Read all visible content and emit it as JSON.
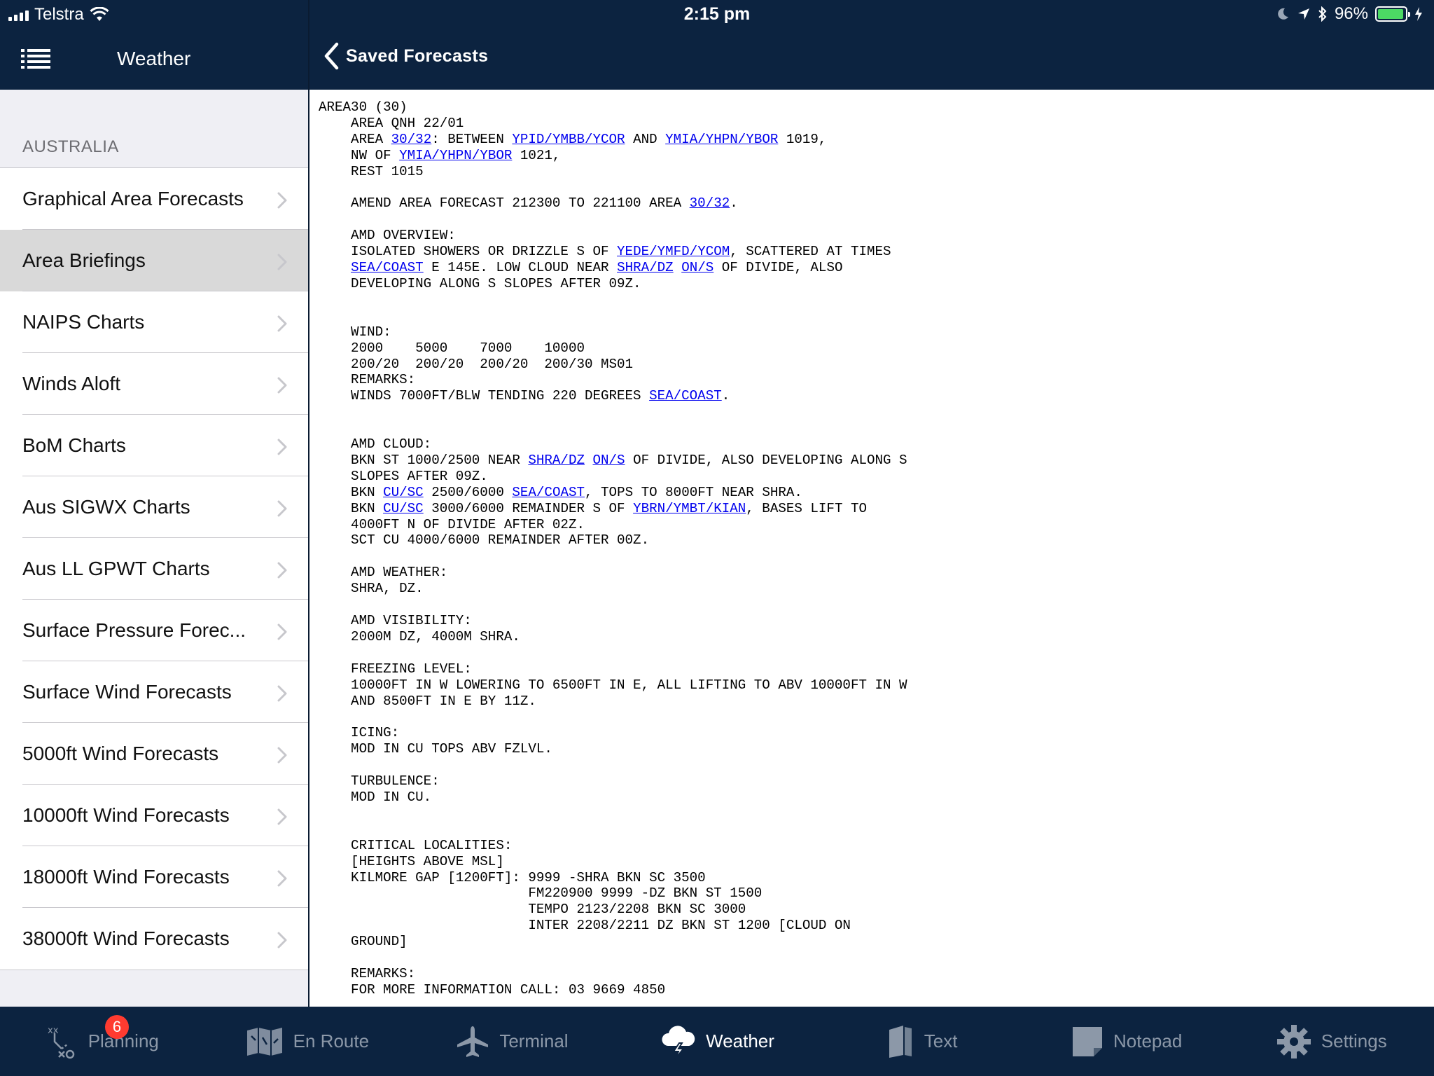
{
  "status_bar": {
    "carrier": "Telstra",
    "time": "2:15 pm",
    "battery": "96%",
    "battery_level": 0.96
  },
  "sidebar": {
    "title": "Weather",
    "section": "AUSTRALIA",
    "items": [
      {
        "label": "Graphical Area Forecasts",
        "selected": false
      },
      {
        "label": "Area Briefings",
        "selected": true
      },
      {
        "label": "NAIPS Charts",
        "selected": false
      },
      {
        "label": "Winds Aloft",
        "selected": false
      },
      {
        "label": "BoM Charts",
        "selected": false
      },
      {
        "label": "Aus SIGWX Charts",
        "selected": false
      },
      {
        "label": "Aus LL GPWT Charts",
        "selected": false
      },
      {
        "label": "Surface Pressure Forec...",
        "selected": false
      },
      {
        "label": "Surface Wind Forecasts",
        "selected": false
      },
      {
        "label": "5000ft Wind Forecasts",
        "selected": false
      },
      {
        "label": "10000ft Wind Forecasts",
        "selected": false
      },
      {
        "label": "18000ft Wind Forecasts",
        "selected": false
      },
      {
        "label": "38000ft Wind Forecasts",
        "selected": false
      }
    ]
  },
  "content": {
    "back_label": "Saved Forecasts",
    "forecast_lines": [
      [
        "AREA30 (30)"
      ],
      [
        "    AREA QNH 22/01"
      ],
      [
        "    AREA ",
        {
          "link": "30/32"
        },
        ": BETWEEN ",
        {
          "link": "YPID/YMBB/YCOR"
        },
        " AND ",
        {
          "link": "YMIA/YHPN/YBOR"
        },
        " 1019,"
      ],
      [
        "    NW OF ",
        {
          "link": "YMIA/YHPN/YBOR"
        },
        " 1021,"
      ],
      [
        "    REST 1015"
      ],
      [
        ""
      ],
      [
        "    AMEND AREA FORECAST 212300 TO 221100 AREA ",
        {
          "link": "30/32"
        },
        "."
      ],
      [
        ""
      ],
      [
        "    AMD OVERVIEW:"
      ],
      [
        "    ISOLATED SHOWERS OR DRIZZLE S OF ",
        {
          "link": "YEDE/YMFD/YCOM"
        },
        ", SCATTERED AT TIMES"
      ],
      [
        "    ",
        {
          "link": "SEA/COAST"
        },
        " E 145E. LOW CLOUD NEAR ",
        {
          "link": "SHRA/DZ"
        },
        " ",
        {
          "link": "ON/S"
        },
        " OF DIVIDE, ALSO"
      ],
      [
        "    DEVELOPING ALONG S SLOPES AFTER 09Z."
      ],
      [
        ""
      ],
      [
        ""
      ],
      [
        "    WIND:"
      ],
      [
        "    2000    5000    7000    10000"
      ],
      [
        "    200/20  200/20  200/20  200/30 MS01"
      ],
      [
        "    REMARKS:"
      ],
      [
        "    WINDS 7000FT/BLW TENDING 220 DEGREES ",
        {
          "link": "SEA/COAST"
        },
        "."
      ],
      [
        ""
      ],
      [
        ""
      ],
      [
        "    AMD CLOUD:"
      ],
      [
        "    BKN ST 1000/2500 NEAR ",
        {
          "link": "SHRA/DZ"
        },
        " ",
        {
          "link": "ON/S"
        },
        " OF DIVIDE, ALSO DEVELOPING ALONG S"
      ],
      [
        "    SLOPES AFTER 09Z."
      ],
      [
        "    BKN ",
        {
          "link": "CU/SC"
        },
        " 2500/6000 ",
        {
          "link": "SEA/COAST"
        },
        ", TOPS TO 8000FT NEAR SHRA."
      ],
      [
        "    BKN ",
        {
          "link": "CU/SC"
        },
        " 3000/6000 REMAINDER S OF ",
        {
          "link": "YBRN/YMBT/KIAN"
        },
        ", BASES LIFT TO"
      ],
      [
        "    4000FT N OF DIVIDE AFTER 02Z."
      ],
      [
        "    SCT CU 4000/6000 REMAINDER AFTER 00Z."
      ],
      [
        ""
      ],
      [
        "    AMD WEATHER:"
      ],
      [
        "    SHRA, DZ."
      ],
      [
        ""
      ],
      [
        "    AMD VISIBILITY:"
      ],
      [
        "    2000M DZ, 4000M SHRA."
      ],
      [
        ""
      ],
      [
        "    FREEZING LEVEL:"
      ],
      [
        "    10000FT IN W LOWERING TO 6500FT IN E, ALL LIFTING TO ABV 10000FT IN W"
      ],
      [
        "    AND 8500FT IN E BY 11Z."
      ],
      [
        ""
      ],
      [
        "    ICING:"
      ],
      [
        "    MOD IN CU TOPS ABV FZLVL."
      ],
      [
        ""
      ],
      [
        "    TURBULENCE:"
      ],
      [
        "    MOD IN CU."
      ],
      [
        ""
      ],
      [
        ""
      ],
      [
        "    CRITICAL LOCALITIES:"
      ],
      [
        "    [HEIGHTS ABOVE MSL]"
      ],
      [
        "    KILMORE GAP [1200FT]: 9999 -SHRA BKN SC 3500"
      ],
      [
        "                          FM220900 9999 -DZ BKN ST 1500"
      ],
      [
        "                          TEMPO 2123/2208 BKN SC 3000"
      ],
      [
        "                          INTER 2208/2211 DZ BKN ST 1200 [CLOUD ON"
      ],
      [
        "    GROUND]"
      ],
      [
        ""
      ],
      [
        "    REMARKS:"
      ],
      [
        "    FOR MORE INFORMATION CALL: 03 9669 4850"
      ]
    ]
  },
  "tabbar": {
    "tabs": [
      {
        "label": "Planning",
        "icon": "planning-icon",
        "badge": "6",
        "active": false
      },
      {
        "label": "En Route",
        "icon": "map-icon",
        "active": false
      },
      {
        "label": "Terminal",
        "icon": "airplane-icon",
        "active": false
      },
      {
        "label": "Weather",
        "icon": "weather-icon",
        "active": true
      },
      {
        "label": "Text",
        "icon": "book-icon",
        "active": false
      },
      {
        "label": "Notepad",
        "icon": "notepad-icon",
        "active": false
      },
      {
        "label": "Settings",
        "icon": "gear-icon",
        "active": false
      }
    ]
  }
}
